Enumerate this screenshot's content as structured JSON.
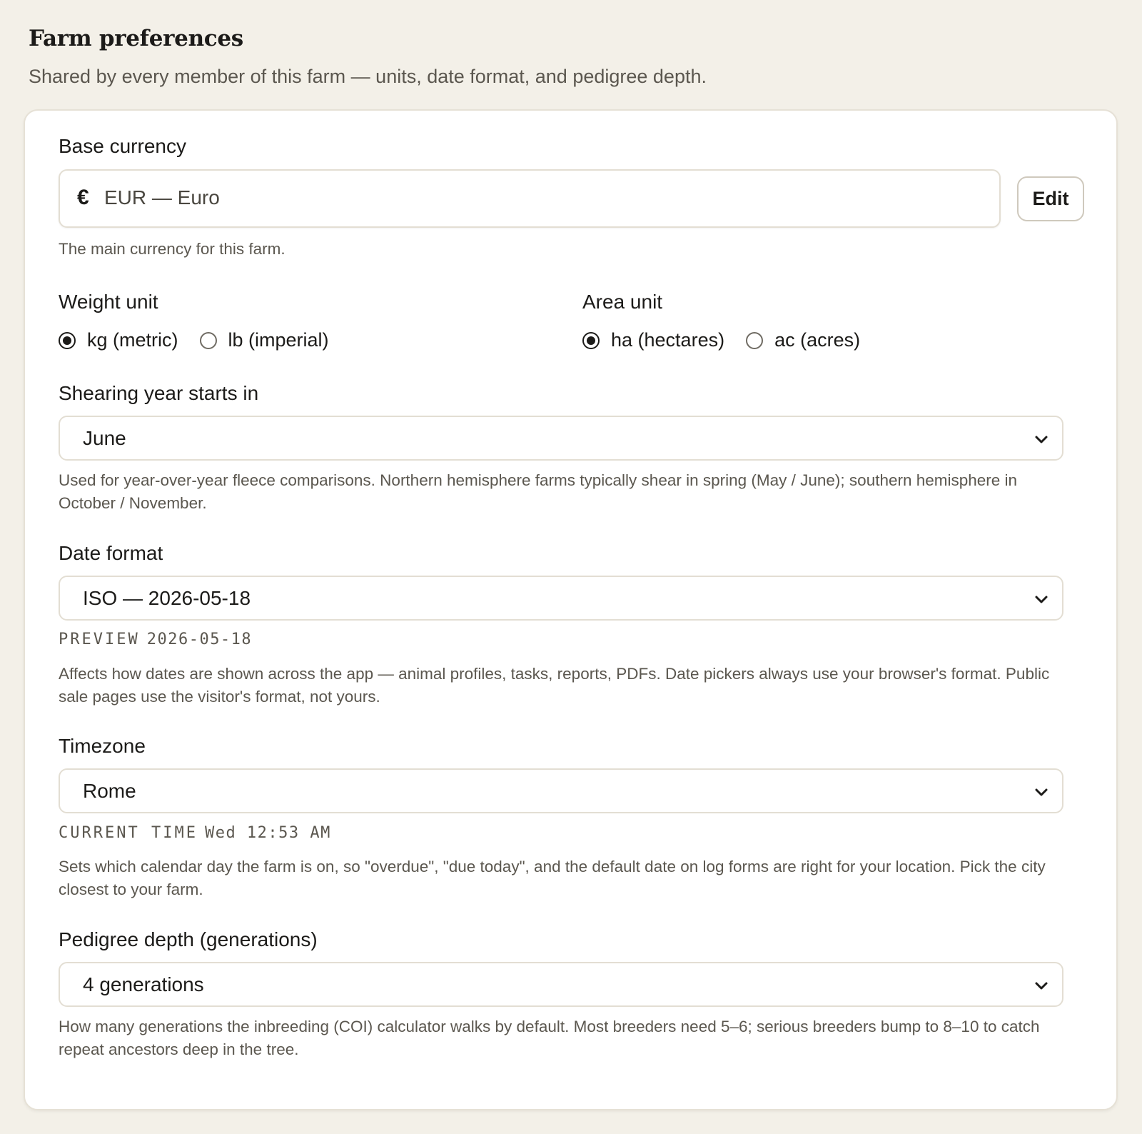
{
  "header": {
    "title": "Farm preferences",
    "subtitle": "Shared by every member of this farm — units, date format, and pedigree depth."
  },
  "currency": {
    "label": "Base currency",
    "symbol": "€",
    "value": "EUR — Euro",
    "edit_label": "Edit",
    "help": "The main currency for this farm."
  },
  "weight": {
    "label": "Weight unit",
    "options": [
      {
        "label": "kg (metric)",
        "selected": true
      },
      {
        "label": "lb (imperial)",
        "selected": false
      }
    ]
  },
  "area": {
    "label": "Area unit",
    "options": [
      {
        "label": "ha (hectares)",
        "selected": true
      },
      {
        "label": "ac (acres)",
        "selected": false
      }
    ]
  },
  "shearing": {
    "label": "Shearing year starts in",
    "value": "June",
    "help": "Used for year-over-year fleece comparisons. Northern hemisphere farms typically shear in spring (May / June); southern hemisphere in October / November."
  },
  "date_format": {
    "label": "Date format",
    "value": "ISO — 2026-05-18",
    "preview_key": "PREVIEW",
    "preview_value": "2026-05-18",
    "help": "Affects how dates are shown across the app — animal profiles, tasks, reports, PDFs. Date pickers always use your browser's format. Public sale pages use the visitor's format, not yours."
  },
  "timezone": {
    "label": "Timezone",
    "value": "Rome",
    "current_key": "CURRENT TIME",
    "current_value": "Wed 12:53 AM",
    "help": "Sets which calendar day the farm is on, so \"overdue\", \"due today\", and the default date on log forms are right for your location. Pick the city closest to your farm."
  },
  "pedigree": {
    "label": "Pedigree depth (generations)",
    "value": "4 generations",
    "help": "How many generations the inbreeding (COI) calculator walks by default. Most breeders need 5–6; serious breeders bump to 8–10 to catch repeat ancestors deep in the tree."
  },
  "icons": {
    "select_arrow": "chevron-down-icon"
  }
}
